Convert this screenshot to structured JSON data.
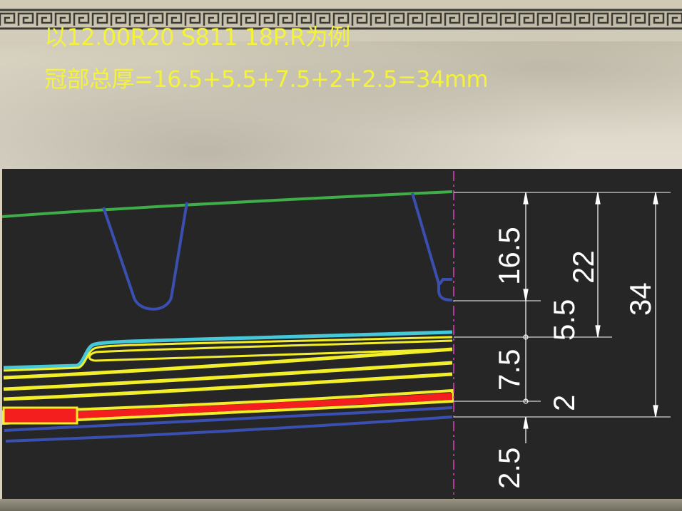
{
  "slide": {
    "title_line_1": "以12.00R20 S811 18P.R为例",
    "title_line_2": "冠部总厚=16.5+5.5+7.5+2+2.5=34mm",
    "title_color": "#f4f23a"
  },
  "drawing": {
    "background_color": "#262626",
    "dimension_labels": {
      "d1": "16.5",
      "d2": "5.5",
      "d3": "7.5",
      "d4": "2",
      "d5": "2.5",
      "d6": "22",
      "d7": "34"
    },
    "layer_colors": {
      "tread_surface": "#3fae49",
      "groove": "#3a4fb0",
      "breaker_edge": "#45c8d8",
      "belts": "#f2ee2a",
      "ply": "#f41e1e",
      "inner_liner": "#3a4fb0",
      "dimension_lines": "#ffffff",
      "center_line": "#e040c0"
    }
  }
}
